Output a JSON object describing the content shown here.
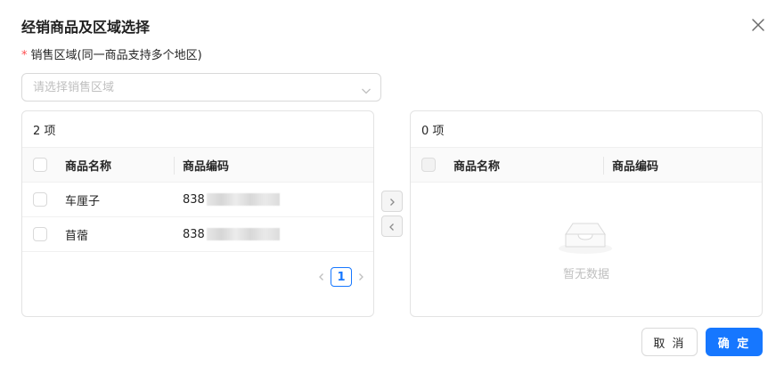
{
  "dialog": {
    "title": "经销商品及区域选择",
    "field_required_mark": "*",
    "field_label": "销售区域(同一商品支持多个地区)",
    "select_placeholder": "请选择销售区域"
  },
  "left_panel": {
    "count_label": "2 项",
    "columns": [
      "商品名称",
      "商品编码"
    ],
    "rows": [
      {
        "name": "车厘子",
        "code": "838"
      },
      {
        "name": "苜蓿",
        "code": "838"
      }
    ],
    "current_page": "1"
  },
  "right_panel": {
    "count_label": "0 项",
    "columns": [
      "商品名称",
      "商品编码"
    ],
    "empty_text": "暂无数据"
  },
  "footer": {
    "cancel_label": "取 消",
    "ok_label": "确 定"
  },
  "colors": {
    "primary": "#1677ff",
    "required": "#ff4d4f"
  },
  "icons": {
    "close": "close-icon",
    "select_arrow": "chevron-down-icon",
    "transfer_right": "chevron-right-icon",
    "transfer_left": "chevron-left-icon",
    "empty": "empty-inbox-icon"
  }
}
